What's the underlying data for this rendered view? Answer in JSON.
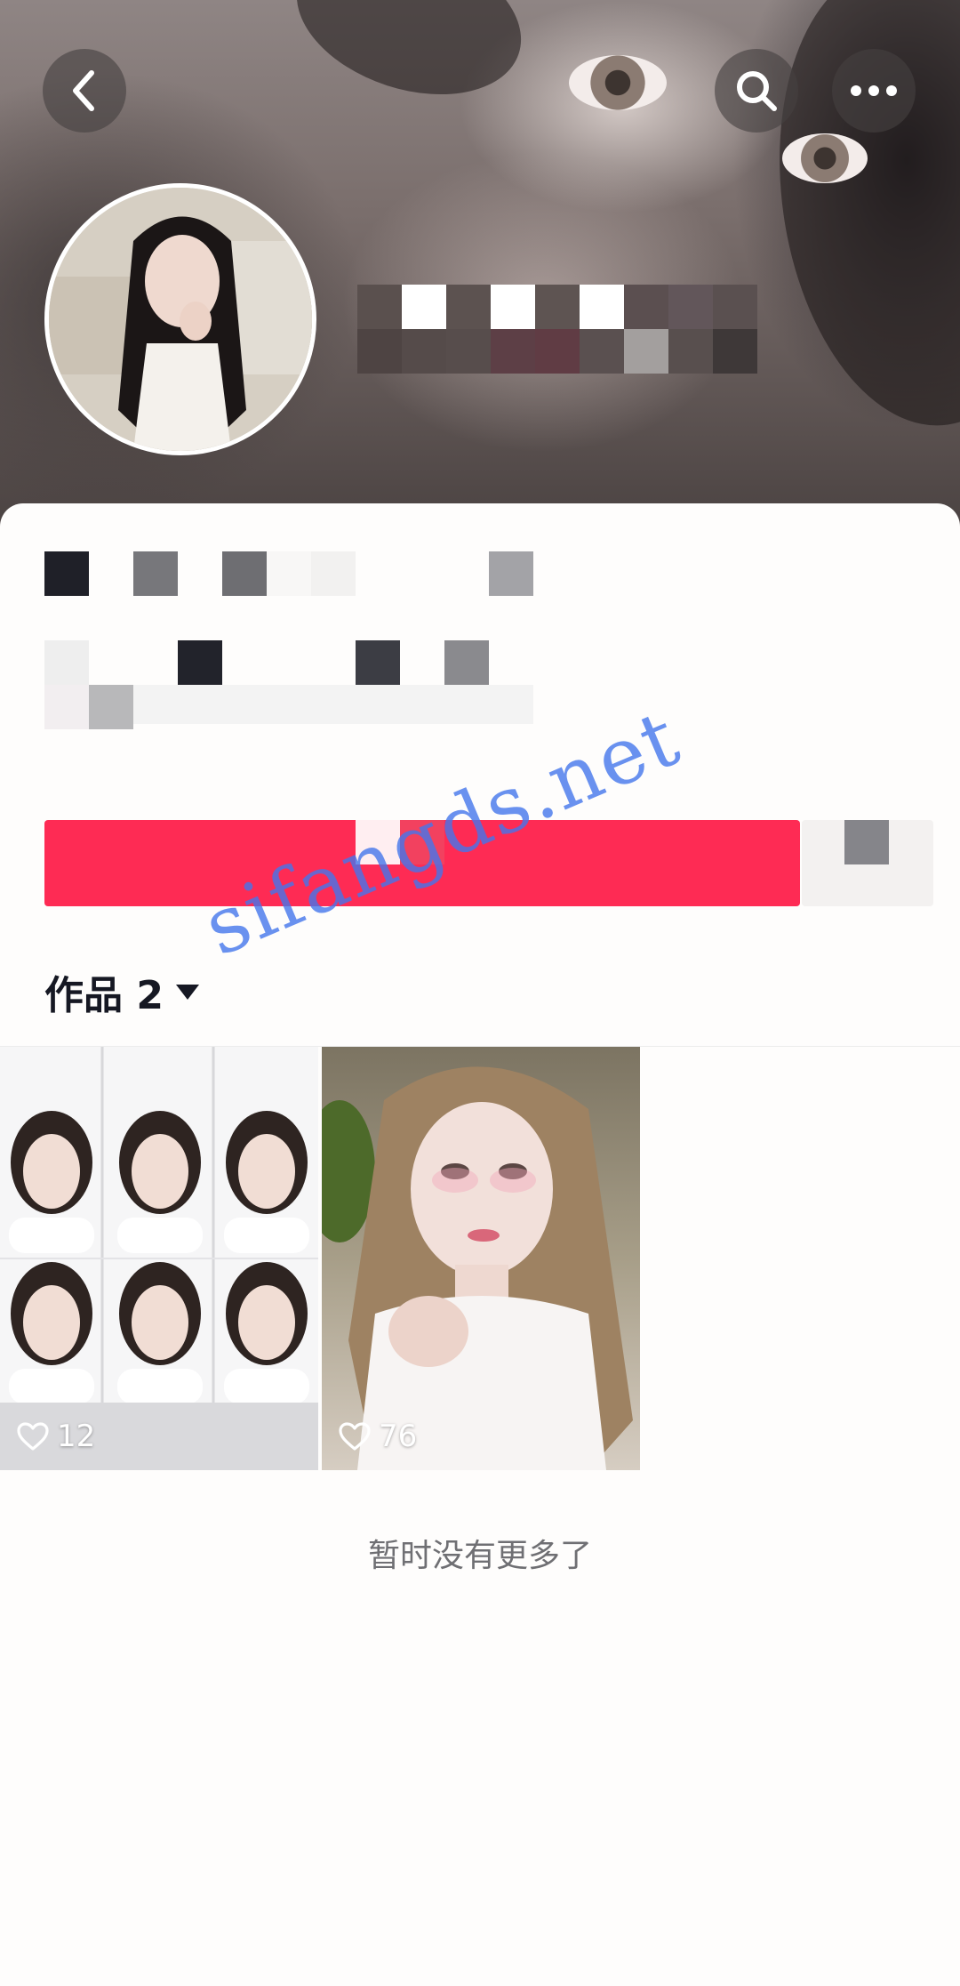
{
  "header": {
    "back_icon": "chevron-left-icon",
    "search_icon": "search-icon",
    "more_icon": "more-dots-icon"
  },
  "tabs": {
    "works_label": "作品 2"
  },
  "posts": [
    {
      "likes": "12",
      "like_icon": "heart-outline-icon"
    },
    {
      "likes": "76",
      "like_icon": "heart-outline-icon"
    }
  ],
  "footer": {
    "end_note": "暂时没有更多了"
  },
  "watermark": "sifangds.net",
  "colors": {
    "primary_button": "#fe2b54",
    "secondary_button": "#f3f1f0",
    "text_dark": "#161823",
    "text_muted": "#6f6f73",
    "watermark": "#4476eb"
  }
}
